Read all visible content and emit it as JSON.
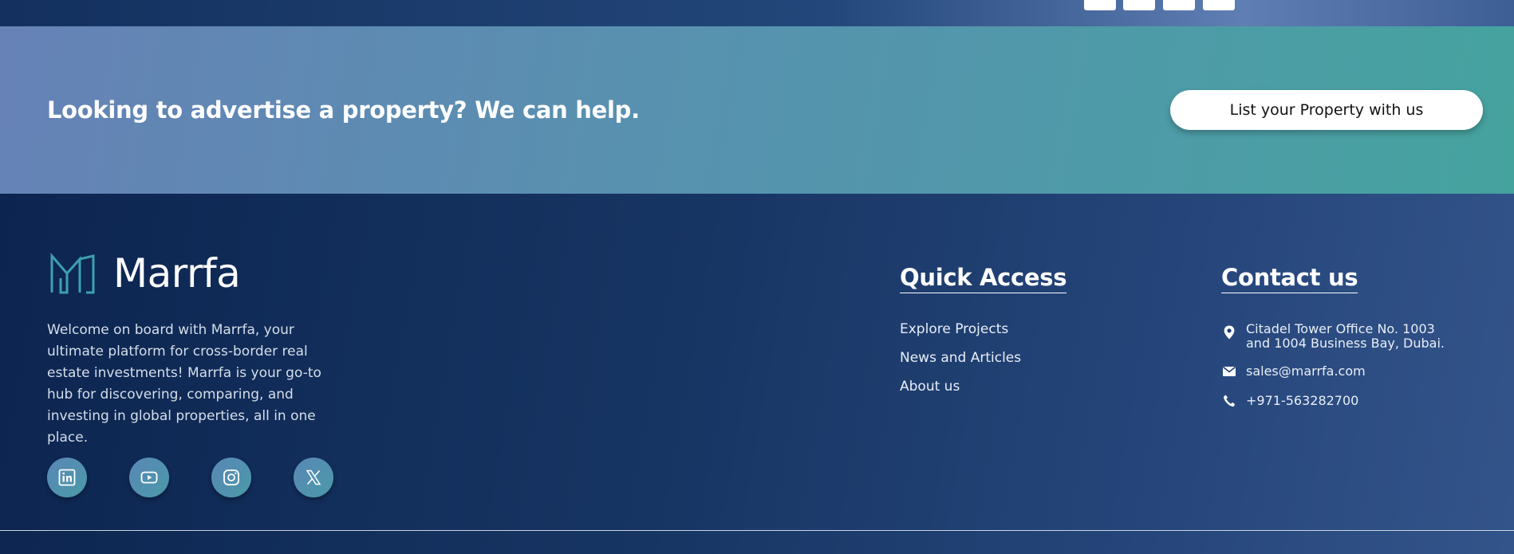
{
  "top_strip": {
    "thumbnails": [
      "thumb-1",
      "thumb-2",
      "thumb-3",
      "thumb-4"
    ]
  },
  "cta": {
    "headline": "Looking to advertise a property? We can help.",
    "button_label": "List your Property with us"
  },
  "brand": {
    "name": "Marrfa",
    "logo_icon": "marrfa-logo-icon",
    "description": "Welcome on board with Marrfa, your ultimate platform for cross-border real estate investments! Marrfa is your go-to hub for discovering, comparing, and investing in global properties, all in one place."
  },
  "socials": [
    {
      "name": "linkedin-icon"
    },
    {
      "name": "youtube-icon"
    },
    {
      "name": "instagram-icon"
    },
    {
      "name": "x-icon"
    }
  ],
  "quick_access": {
    "title": "Quick Access",
    "links": [
      "Explore Projects",
      "News and Articles",
      "About us"
    ]
  },
  "contact": {
    "title": "Contact us",
    "address": "Citadel Tower Office No. 1003 and 1004 Business Bay, Dubai.",
    "email": "sales@marrfa.com",
    "phone": "+971-563282700"
  },
  "colors": {
    "footer_bg": "#0c2550",
    "cta_gradient_start": "#6682b6",
    "cta_gradient_end": "#45a39e",
    "logo_teal": "#3f9fb0"
  }
}
